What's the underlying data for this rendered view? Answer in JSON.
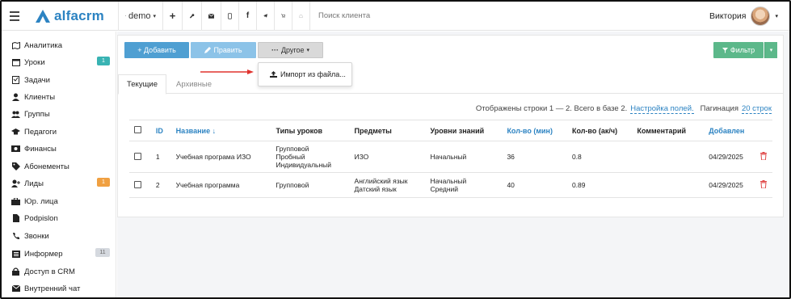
{
  "app": {
    "logo_text": "alfacrm",
    "brand_color": "#2c83c2"
  },
  "topbar": {
    "branch_label": "demo",
    "search_placeholder": "Поиск клиента",
    "user_name": "Виктория",
    "icons": [
      "plus-icon",
      "wrench-icon",
      "mail-icon",
      "phone-icon",
      "facebook-icon",
      "telegram-icon",
      "cart-icon",
      "bell-icon"
    ]
  },
  "sidebar": {
    "items": [
      {
        "label": "Аналитика",
        "icon": "map-icon"
      },
      {
        "label": "Уроки",
        "icon": "calendar-icon",
        "badge": "1"
      },
      {
        "label": "Задачи",
        "icon": "task-icon"
      },
      {
        "label": "Клиенты",
        "icon": "user-icon"
      },
      {
        "label": "Группы",
        "icon": "users-icon"
      },
      {
        "label": "Педагоги",
        "icon": "graduation-cap-icon"
      },
      {
        "label": "Финансы",
        "icon": "money-icon"
      },
      {
        "label": "Абонементы",
        "icon": "tag-icon"
      },
      {
        "label": "Лиды",
        "icon": "user-plus-icon",
        "badge": "1"
      },
      {
        "label": "Юр. лица",
        "icon": "briefcase-icon"
      },
      {
        "label": "Podpislon",
        "icon": "file-icon"
      },
      {
        "label": "Звонки",
        "icon": "phone-icon"
      },
      {
        "label": "Информер",
        "icon": "list-icon",
        "badge": "11"
      },
      {
        "label": "Доступ в CRM",
        "icon": "lock-icon"
      },
      {
        "label": "Внутренний чат",
        "icon": "envelope-icon"
      }
    ]
  },
  "toolbar": {
    "add_label": "+ Добавить",
    "edit_label": "Править",
    "other_label": "Другое",
    "filter_label": "Фильтр"
  },
  "dropdown": {
    "import_label": "Импорт из файла..."
  },
  "tabs": [
    {
      "label": "Текущие",
      "active": true
    },
    {
      "label": "Архивные",
      "active": false
    }
  ],
  "summary": {
    "rows_text": "Отображены строки 1 — 2. Всего в базе 2.",
    "settings_link": "Настройка полей.",
    "pagination_label": "Пагинация",
    "pagination_link": "20 строк"
  },
  "table": {
    "headers": [
      "ID",
      "Название ↓",
      "Типы уроков",
      "Предметы",
      "Уровни знаний",
      "Кол-во (мин)",
      "Кол-во (ак/ч)",
      "Комментарий",
      "Добавлен"
    ],
    "rows": [
      {
        "id": "1",
        "name": "Учебная програма ИЗО",
        "types": [
          "Групповой",
          "Пробный",
          "Индивидуальный"
        ],
        "subjects": [
          "ИЗО"
        ],
        "levels": [
          "Начальный"
        ],
        "minutes": "36",
        "hours": "0.8",
        "comment": "",
        "added": "04/29/2025"
      },
      {
        "id": "2",
        "name": "Учебная программа",
        "types": [
          "Групповой"
        ],
        "subjects": [
          "Английский язык",
          "Датский язык"
        ],
        "levels": [
          "Начальный",
          "Средний"
        ],
        "minutes": "40",
        "hours": "0.89",
        "comment": "",
        "added": "04/29/2025"
      }
    ]
  }
}
